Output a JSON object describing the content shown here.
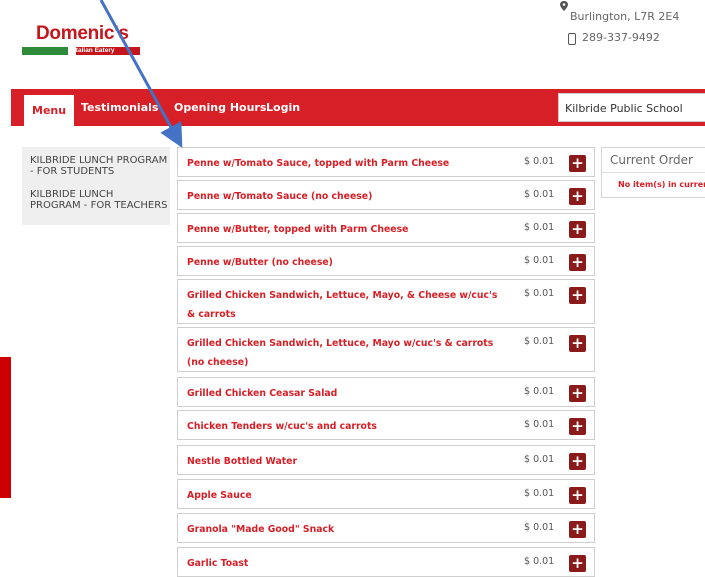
{
  "header": {
    "logo_text": "Domenic's",
    "logo_subtext": "Italian Eatery",
    "address_line": "Burlington, L7R 2E4",
    "phone": "289-337-9492"
  },
  "nav": {
    "items": [
      "Menu",
      "Testimonials",
      "Opening Hours",
      "Login"
    ],
    "school_select": "Kilbride Public School"
  },
  "sidebar": {
    "items": [
      {
        "line1": "KILBRIDE LUNCH PROGRAM",
        "line2": "- FOR STUDENTS"
      },
      {
        "line1": "KILBRIDE LUNCH",
        "line2": "PROGRAM - FOR TEACHERS"
      }
    ]
  },
  "menu": {
    "add_symbol": "+",
    "items": [
      {
        "name": "Penne w/Tomato Sauce, topped with Parm Cheese",
        "price": "$ 0.01"
      },
      {
        "name": "Penne w/Tomato Sauce (no cheese)",
        "price": "$ 0.01"
      },
      {
        "name": "Penne w/Butter, topped with Parm Cheese",
        "price": "$ 0.01"
      },
      {
        "name": "Penne w/Butter (no cheese)",
        "price": "$ 0.01"
      },
      {
        "name": "Grilled Chicken Sandwich, Lettuce, Mayo, & Cheese w/cuc's & carrots",
        "price": "$ 0.01"
      },
      {
        "name": "Grilled Chicken Sandwich, Lettuce, Mayo w/cuc's & carrots (no cheese)",
        "price": "$ 0.01"
      },
      {
        "name": "Grilled Chicken Ceasar Salad",
        "price": "$ 0.01"
      },
      {
        "name": "Chicken Tenders w/cuc's and carrots",
        "price": "$ 0.01"
      },
      {
        "name": "Nestle Bottled Water",
        "price": "$ 0.01"
      },
      {
        "name": "Apple Sauce",
        "price": "$ 0.01"
      },
      {
        "name": "Granola \"Made Good\" Snack",
        "price": "$ 0.01"
      },
      {
        "name": "Garlic Toast",
        "price": "$ 0.01"
      }
    ]
  },
  "order": {
    "title": "Current Order",
    "empty_text": "No item(s) in curren"
  },
  "colors": {
    "brand_red": "#d61f26",
    "button_dark_red": "#8b1a1a",
    "arrow_blue": "#4472c4"
  },
  "icons": {
    "address": "map-pin-icon",
    "phone": "mobile-phone-icon",
    "add": "plus-icon"
  }
}
